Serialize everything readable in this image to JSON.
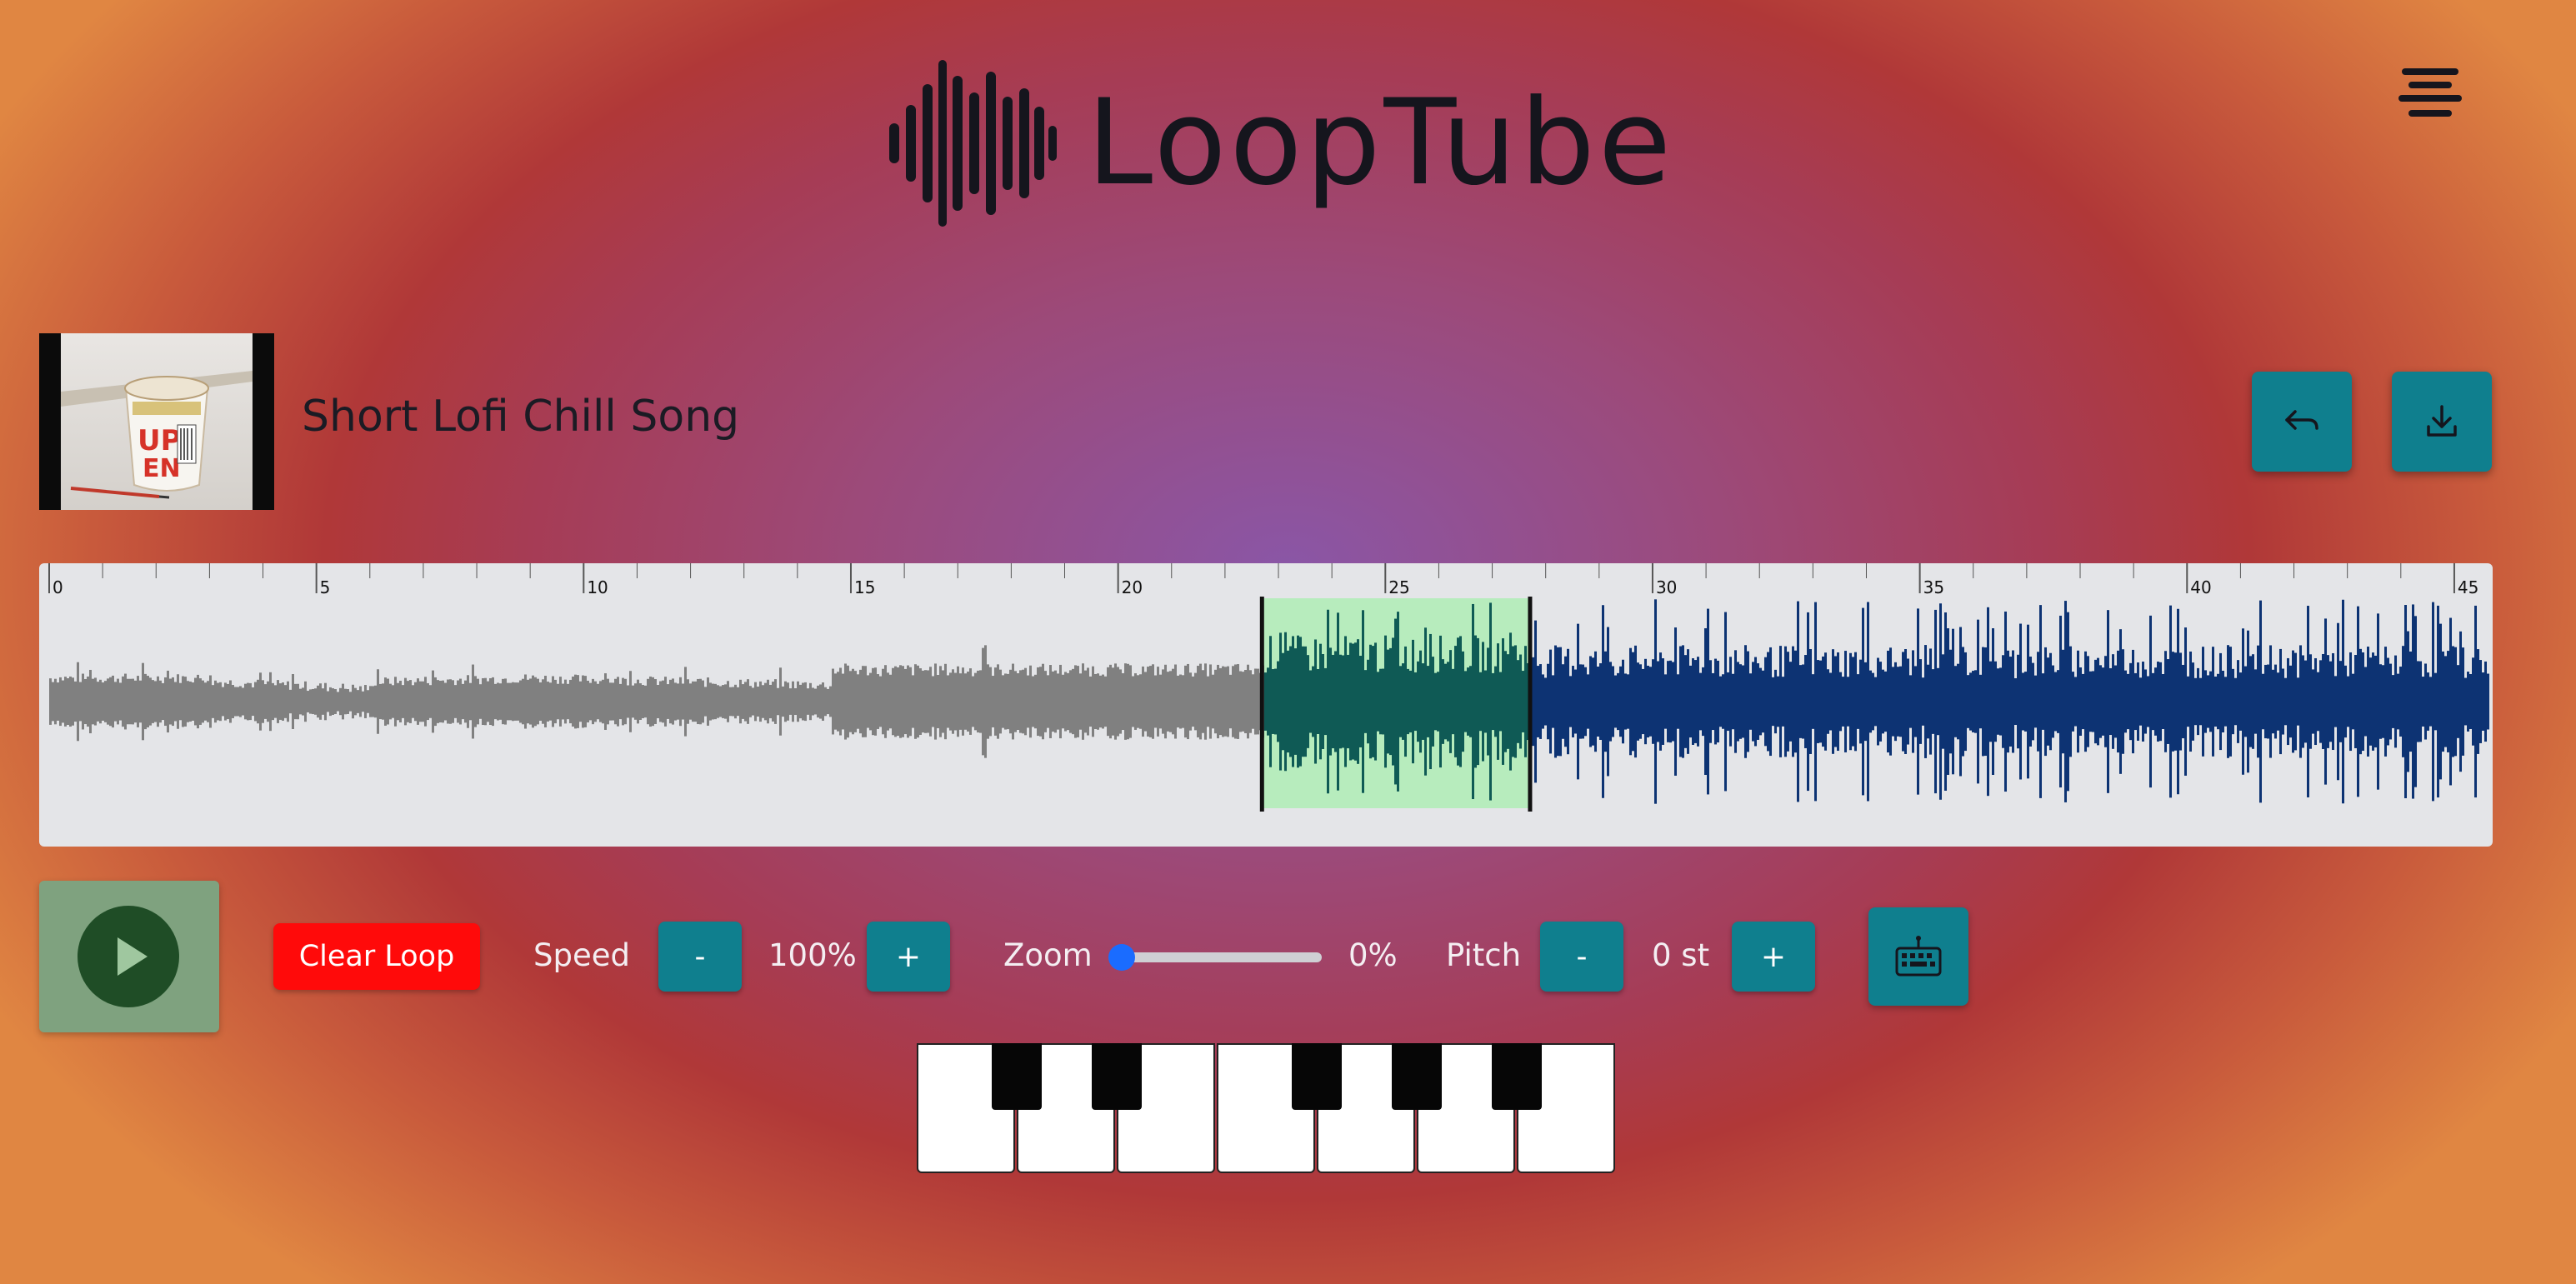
{
  "app": {
    "title": "LoopTube"
  },
  "header": {
    "logo_icon": "waveform-icon",
    "menu_icon": "menu-lines-icon"
  },
  "track": {
    "title": "Short Lofi Chill Song",
    "thumbnail": "noodle-cup-thumbnail"
  },
  "actions": {
    "back_icon": "undo-arrow-icon",
    "download_icon": "download-icon"
  },
  "waveform": {
    "tick_labels": [
      "0",
      "5",
      "10",
      "15",
      "20",
      "25",
      "30",
      "35",
      "40",
      "45"
    ],
    "duration_seconds": 45.5,
    "loop_start_seconds": 22.7,
    "loop_end_seconds": 27.7,
    "colors": {
      "played": "#808080",
      "loop": "#0f5a55",
      "loop_background": "#b7ecbd",
      "unplayed": "#0d3373"
    }
  },
  "controls": {
    "play_icon": "play-icon",
    "clear_loop_label": "Clear Loop",
    "speed": {
      "label": "Speed",
      "minus": "-",
      "plus": "+",
      "value": "100%"
    },
    "zoom": {
      "label": "Zoom",
      "value": "0%",
      "level": 0
    },
    "pitch": {
      "label": "Pitch",
      "minus": "-",
      "plus": "+",
      "value": "0 st"
    },
    "keyboard_icon": "keyboard-icon"
  },
  "piano": {
    "white_keys": 7,
    "black_keys": 5
  },
  "colors": {
    "accent": "#0f7f8e",
    "clear_loop": "#ff0a0a",
    "play_background": "#7fa27f"
  }
}
